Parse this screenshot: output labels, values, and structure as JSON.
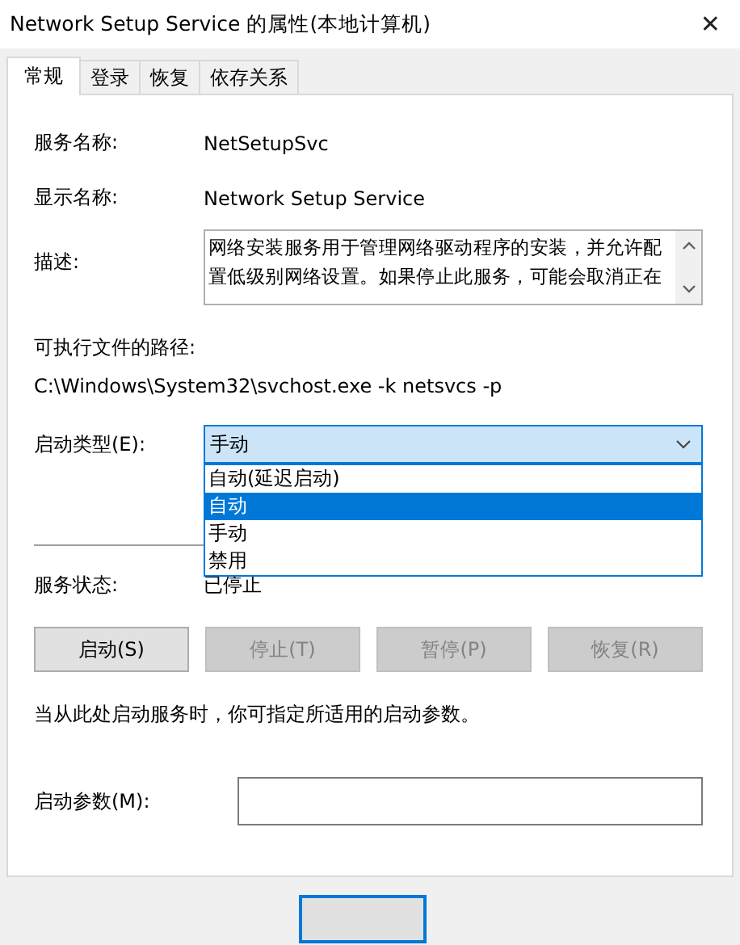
{
  "window": {
    "title": "Network Setup Service 的属性(本地计算机)",
    "close": "✕"
  },
  "tabs": [
    {
      "label": "常规",
      "selected": true
    },
    {
      "label": "登录",
      "selected": false
    },
    {
      "label": "恢复",
      "selected": false
    },
    {
      "label": "依存关系",
      "selected": false
    }
  ],
  "general": {
    "fields": [
      {
        "label": "服务名称:",
        "value": "NetSetupSvc"
      },
      {
        "label": "显示名称:",
        "value": "Network Setup Service"
      }
    ],
    "description": {
      "label": "描述:",
      "text": "网络安装服务用于管理网络驱动程序的安装，并允许配置低级别网络设置。如果停止此服务，可能会取消正在"
    },
    "path": {
      "label": "可执行文件的路径:",
      "value": "C:\\Windows\\System32\\svchost.exe -k netsvcs -p"
    },
    "startup_type": {
      "label": "启动类型(E):",
      "value": "手动",
      "expanded": true,
      "options": [
        {
          "label": "自动(延迟启动)",
          "highlighted": false
        },
        {
          "label": "自动",
          "highlighted": true
        },
        {
          "label": "手动",
          "highlighted": false
        },
        {
          "label": "禁用",
          "highlighted": false
        }
      ]
    },
    "status": {
      "label": "服务状态:",
      "value": "已停止"
    },
    "buttons": [
      {
        "label": "启动(S)",
        "disabled": false
      },
      {
        "label": "停止(T)",
        "disabled": true
      },
      {
        "label": "暂停(P)",
        "disabled": true
      },
      {
        "label": "恢复(R)",
        "disabled": true
      }
    ],
    "hint": "当从此处启动服务时，你可指定所适用的启动参数。",
    "parameters": {
      "label": "启动参数(M):"
    }
  }
}
